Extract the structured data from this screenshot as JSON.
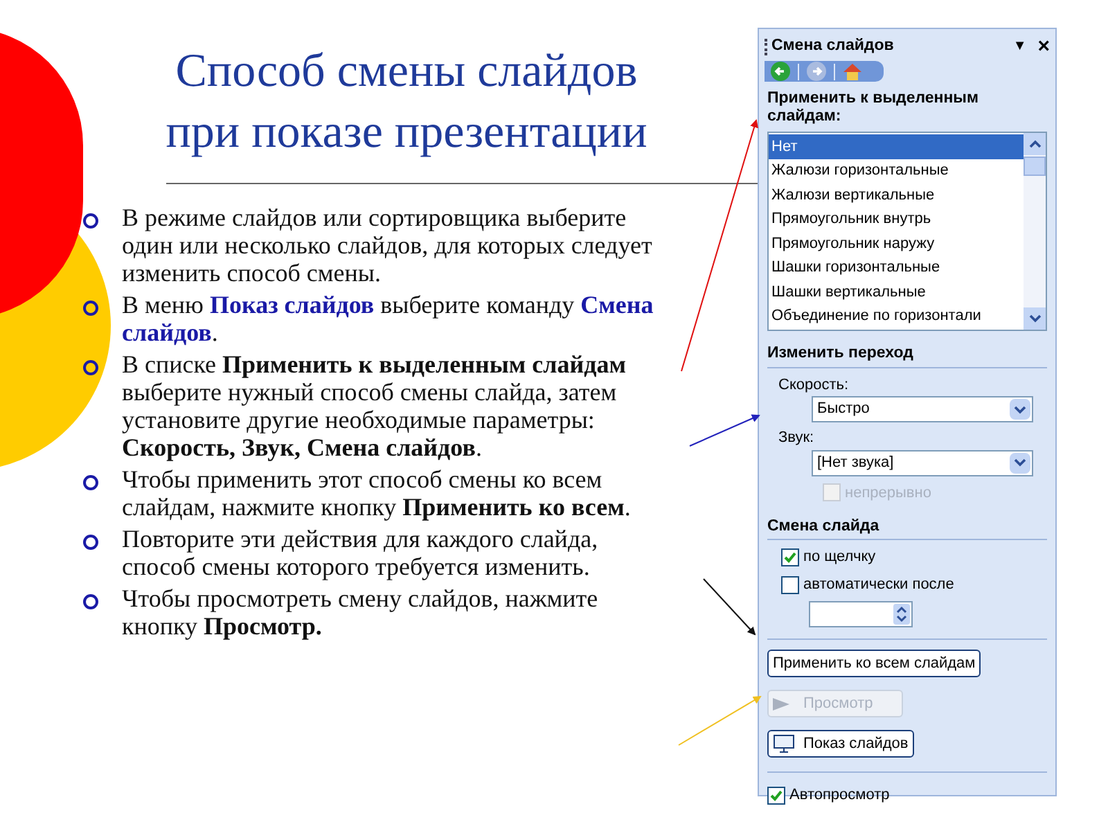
{
  "slide": {
    "title_lines": [
      "Способ смены слайдов",
      "при показе презентации"
    ],
    "bullets": [
      [
        {
          "text": "В режиме слайдов или сортировщика выберите один или несколько слайдов, для которых следует изменить способ смены.",
          "kind": "plain"
        }
      ],
      [
        {
          "text": "В меню ",
          "kind": "plain"
        },
        {
          "text": "Показ слайдов",
          "kind": "accent"
        },
        {
          "text": " выберите команду ",
          "kind": "plain"
        },
        {
          "text": "Смена слайдов",
          "kind": "accent"
        },
        {
          "text": ".",
          "kind": "plain"
        }
      ],
      [
        {
          "text": "В списке ",
          "kind": "plain"
        },
        {
          "text": "Применить к выделенным слайдам",
          "kind": "bold"
        },
        {
          "text": " выберите нужный способ смены слайда, затем установите другие необходимые параметры: ",
          "kind": "plain"
        },
        {
          "text": "Скорость, Звук, Смена слайдов",
          "kind": "bold"
        },
        {
          "text": ".",
          "kind": "plain"
        }
      ],
      [
        {
          "text": "Чтобы применить этот способ смены ко всем слайдам, нажмите кнопку ",
          "kind": "plain"
        },
        {
          "text": "Применить ко всем",
          "kind": "bold"
        },
        {
          "text": ".",
          "kind": "plain"
        }
      ],
      [
        {
          "text": "Повторите эти действия для каждого слайда, способ смены которого требуется изменить.",
          "kind": "plain"
        }
      ],
      [
        {
          "text": "Чтобы просмотреть смену слайдов, нажмите кнопку ",
          "kind": "plain"
        },
        {
          "text": "Просмотр.",
          "kind": "bold"
        }
      ]
    ]
  },
  "task_pane": {
    "title": "Смена слайдов",
    "menu_glyph": "▼",
    "close_glyph": "×",
    "apply_heading": "Применить к выделенным слайдам:",
    "transitions": [
      {
        "label": "Нет",
        "selected": true
      },
      {
        "label": "Жалюзи горизонтальные",
        "selected": false
      },
      {
        "label": "Жалюзи вертикальные",
        "selected": false
      },
      {
        "label": "Прямоугольник внутрь",
        "selected": false
      },
      {
        "label": "Прямоугольник наружу",
        "selected": false
      },
      {
        "label": "Шашки горизонтальные",
        "selected": false
      },
      {
        "label": "Шашки вертикальные",
        "selected": false
      },
      {
        "label": "Объединение по горизонтали",
        "selected": false
      }
    ],
    "modify_heading": "Изменить переход",
    "speed_label": "Скорость:",
    "speed_value": "Быстро",
    "sound_label": "Звук:",
    "sound_value": "[Нет звука]",
    "loop": {
      "label": "непрерывно",
      "checked": false,
      "disabled": true
    },
    "advance_heading": "Смена слайда",
    "advance_options": [
      {
        "label": "по щелчку",
        "checked": true
      },
      {
        "label": "автоматически после",
        "checked": false
      }
    ],
    "apply_all_button": "Применить ко всем слайдам",
    "preview_button": {
      "label": "Просмотр",
      "disabled": true
    },
    "slideshow_button": "Показ слайдов",
    "autopreview": {
      "label": "Автопросмотр",
      "checked": true
    }
  }
}
